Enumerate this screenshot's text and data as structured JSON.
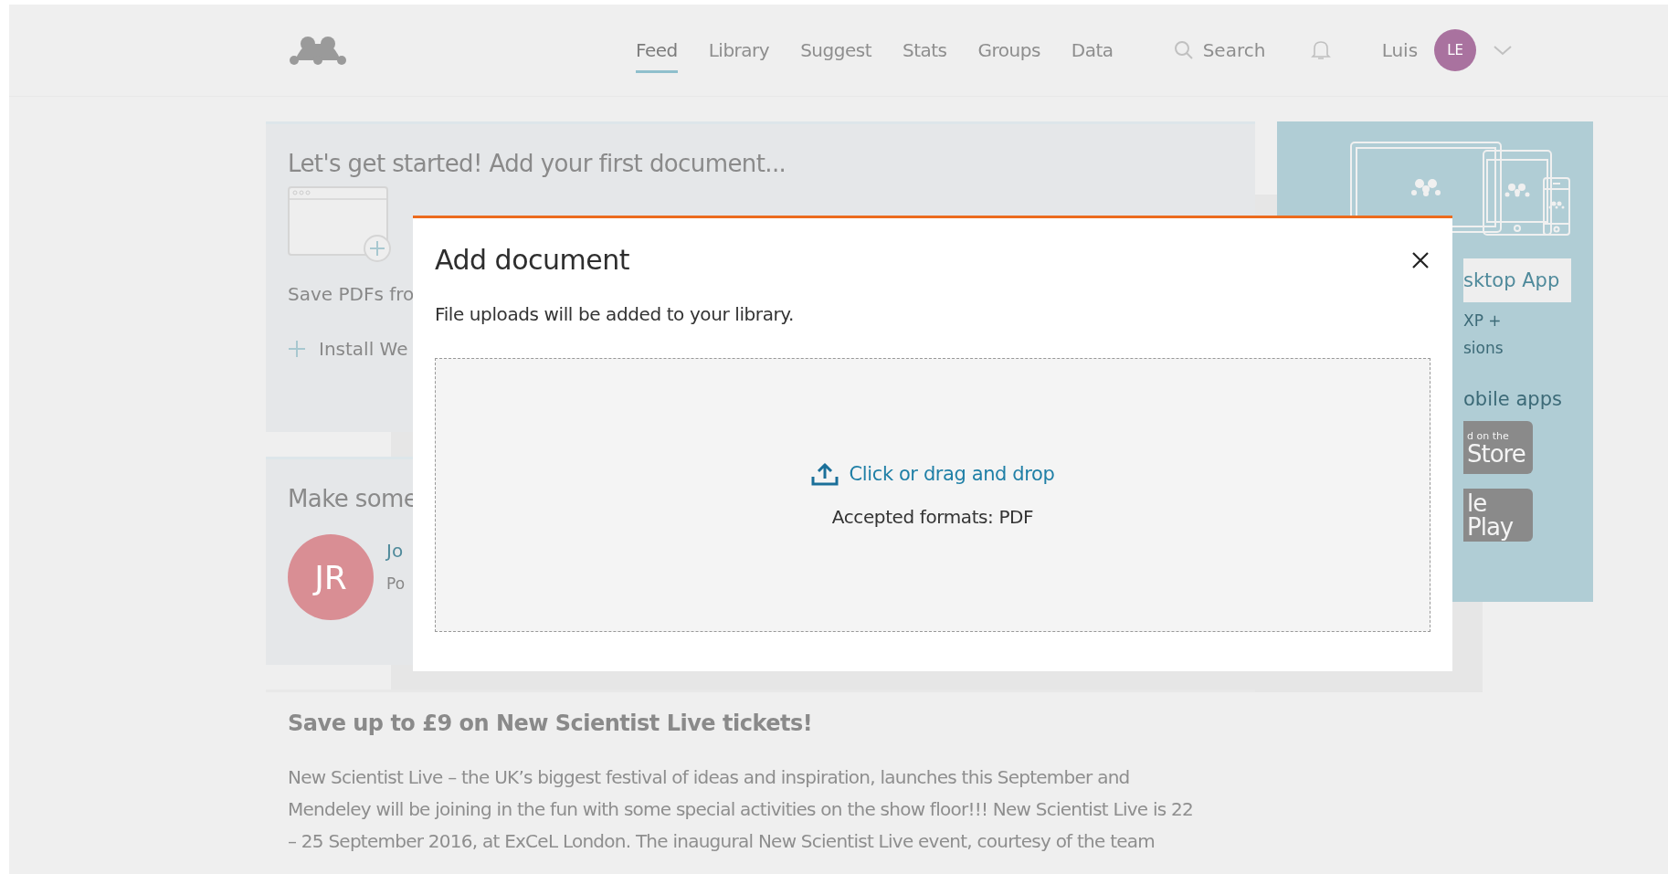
{
  "header": {
    "nav": [
      {
        "label": "Feed",
        "selected": true
      },
      {
        "label": "Library",
        "selected": false
      },
      {
        "label": "Suggest",
        "selected": false
      },
      {
        "label": "Stats",
        "selected": false
      },
      {
        "label": "Groups",
        "selected": false
      },
      {
        "label": "Data",
        "selected": false
      }
    ],
    "search": {
      "placeholder": "Search"
    },
    "user": {
      "name": "Luis",
      "initials": "LE"
    }
  },
  "get_started": {
    "title": "Let's get started! Add your first document...",
    "save_text": "Save PDFs fro",
    "install_link": "Install We"
  },
  "connect": {
    "title": "Make some",
    "avatar_initials": "JR",
    "name": "Jo",
    "subtitle": "Po"
  },
  "promo": {
    "title": "Save up to £9 on New Scientist Live tickets!",
    "body": "New Scientist Live – the UK’s biggest festival of ideas and inspiration, launches this September and Mendeley will be joining in the fun with some special activities on the show floor!!! New Scientist Live is 22 – 25 September 2016, at ExCeL London. The inaugural New Scientist Live event, courtesy of the team"
  },
  "apps_panel": {
    "desktop_button": "sktop App",
    "lines": [
      "XP +",
      "sions"
    ],
    "mobile_title": "obile apps",
    "app_store": {
      "small": "d on the",
      "big": "Store"
    },
    "google_play": {
      "big": "le Play"
    }
  },
  "modal": {
    "title": "Add document",
    "description": "File uploads will be added to your library.",
    "upload_link": "Click or drag and drop",
    "formats": "Accepted formats: PDF"
  }
}
